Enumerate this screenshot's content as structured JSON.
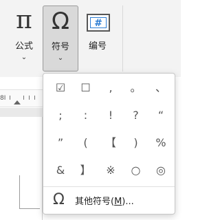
{
  "ribbon": {
    "formula": {
      "label": "公式",
      "icon": "pi-icon",
      "glyph": "π"
    },
    "symbol": {
      "label": "符号",
      "icon": "omega-icon",
      "glyph": "Ω"
    },
    "number": {
      "label": "编号",
      "icon": "numbering-icon",
      "glyph": "#"
    },
    "chevron": "⌄"
  },
  "ruler": {
    "text": "8I"
  },
  "symbol_menu": {
    "symbols": [
      "☑",
      "☐",
      ",",
      "。",
      "、",
      ";",
      ":",
      "!",
      "?",
      "“",
      "”",
      "(",
      "【",
      ")",
      "%",
      "&",
      "】",
      "※",
      "○",
      "◎"
    ],
    "more": {
      "icon": "omega-icon",
      "glyph": "Ω",
      "label_pre": "其他符号(",
      "label_key": "M",
      "label_post": ")..."
    }
  },
  "colors": {
    "accent": "#2b7cd3",
    "selected_button_bg": "#d9d9d9"
  }
}
